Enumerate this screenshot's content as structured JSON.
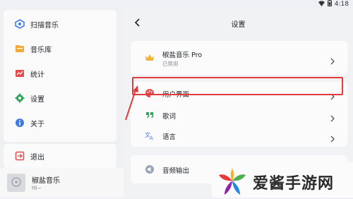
{
  "status": {
    "time": "4:18"
  },
  "sidebar": {
    "items": [
      {
        "label": "扫描音乐",
        "icon": "scan-music-icon"
      },
      {
        "label": "音乐库",
        "icon": "music-library-icon"
      },
      {
        "label": "统计",
        "icon": "statistics-icon"
      },
      {
        "label": "设置",
        "icon": "gear-icon"
      },
      {
        "label": "关于",
        "icon": "info-icon"
      }
    ],
    "exit_label": "退出"
  },
  "player": {
    "title": "椒盐音乐",
    "subtitle": "Hi~"
  },
  "settings": {
    "title": "设置",
    "pro": {
      "title": "椒盐音乐 Pro",
      "subtitle": "已禁用"
    },
    "rows": [
      {
        "label": "用户界面",
        "icon": "palette-icon"
      },
      {
        "label": "歌词",
        "icon": "quote-icon"
      },
      {
        "label": "语言",
        "icon": "translate-icon"
      }
    ],
    "audio_output": "音频输出"
  },
  "watermark": {
    "text": "爱酱手游网"
  },
  "colors": {
    "accent": "#4a8cf0",
    "highlight": "#e23b3b"
  }
}
